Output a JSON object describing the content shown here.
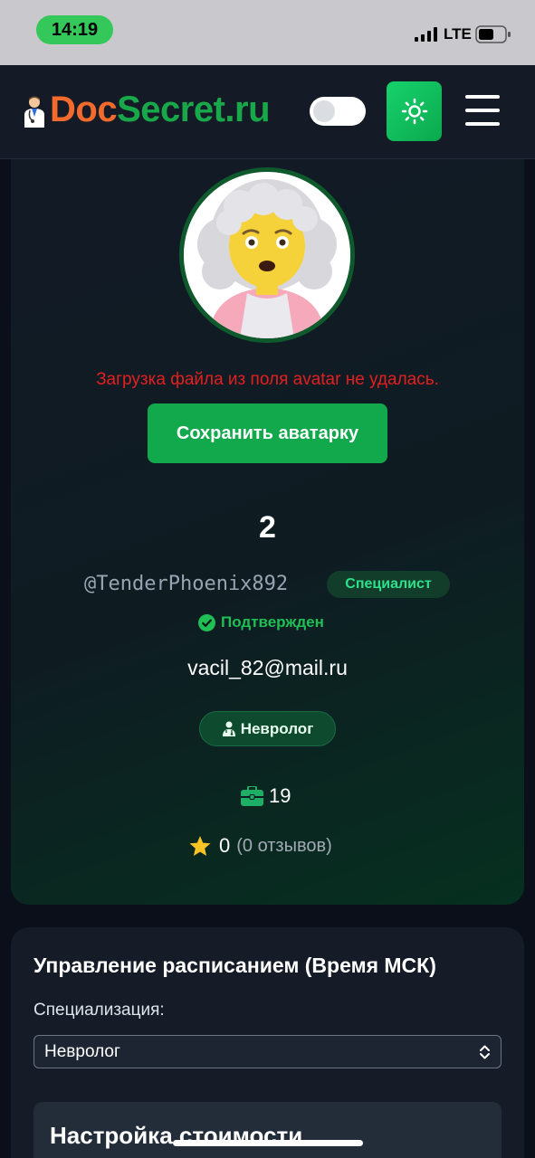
{
  "status_bar": {
    "time": "14:19",
    "network": "LTE"
  },
  "header": {
    "logo_part1": "Doc",
    "logo_part2": "Secret.ru",
    "brand_colors": {
      "doc": "#f26b2c",
      "secret": "#18a84a"
    },
    "theme_toggle_on": false,
    "theme_button_icon": "sun-icon",
    "menu_icon": "hamburger-menu-icon"
  },
  "profile": {
    "avatar_icon": "elderly-woman-avatar",
    "error_message": "Загрузка файла из поля avatar не удалась.",
    "save_avatar_label": "Сохранить аватарку",
    "number": "2",
    "username": "@TenderPhoenix892",
    "role_badge": "Специалист",
    "verified_label": "Подтвержден",
    "email": "vacil_82@mail.ru",
    "specialty": "Невролог",
    "experience": "19",
    "rating": "0",
    "reviews": "(0 отзывов)"
  },
  "schedule": {
    "title": "Управление расписанием (Время МСК)",
    "specialization_label": "Специализация:",
    "specialization_value": "Невролог",
    "price_section_title": "Настройка стоимости"
  }
}
